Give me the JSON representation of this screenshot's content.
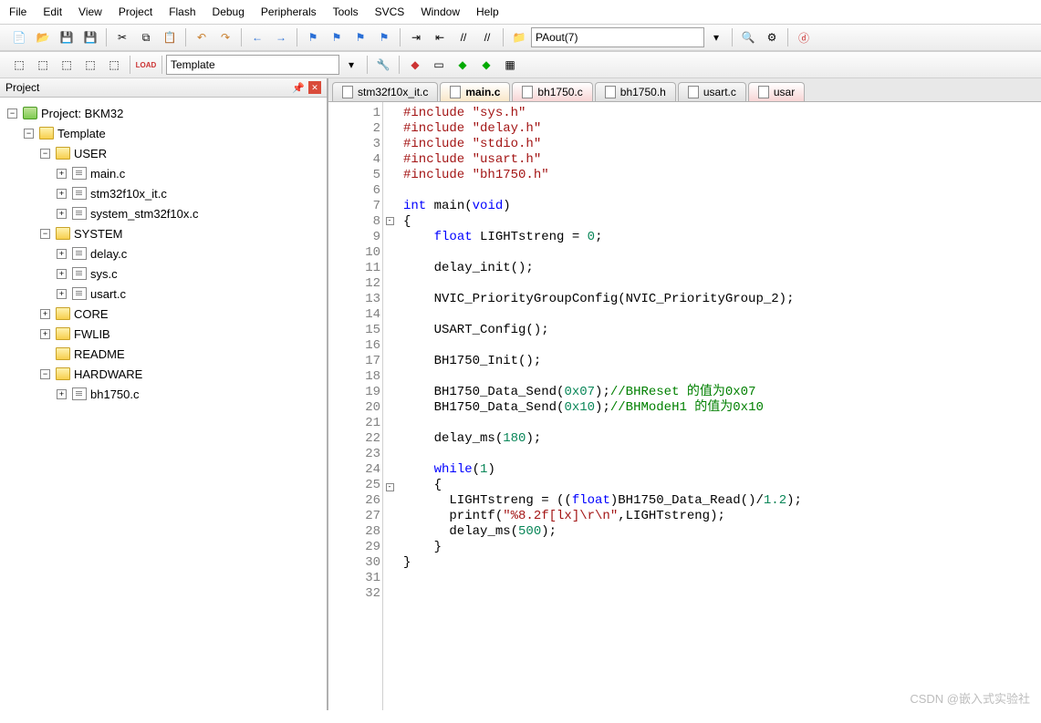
{
  "menu": [
    "File",
    "Edit",
    "View",
    "Project",
    "Flash",
    "Debug",
    "Peripherals",
    "Tools",
    "SVCS",
    "Window",
    "Help"
  ],
  "toolbar1": {
    "combo_text": "PAout(7)"
  },
  "toolbar2": {
    "target_name": "Template"
  },
  "project_pane": {
    "title": "Project",
    "root": "Project: BKM32",
    "target": "Template",
    "groups": [
      {
        "name": "USER",
        "open": true,
        "files": [
          "main.c",
          "stm32f10x_it.c",
          "system_stm32f10x.c"
        ]
      },
      {
        "name": "SYSTEM",
        "open": true,
        "files": [
          "delay.c",
          "sys.c",
          "usart.c"
        ]
      },
      {
        "name": "CORE",
        "open": false,
        "files": []
      },
      {
        "name": "FWLIB",
        "open": false,
        "files": []
      },
      {
        "name": "README",
        "open": false,
        "files": [],
        "noexpand": true
      },
      {
        "name": "HARDWARE",
        "open": true,
        "files": [
          "bh1750.c"
        ]
      }
    ]
  },
  "tabs": [
    {
      "label": "stm32f10x_it.c",
      "style": "plain"
    },
    {
      "label": "main.c",
      "style": "active"
    },
    {
      "label": "bh1750.c",
      "style": "pink"
    },
    {
      "label": "bh1750.h",
      "style": "plain"
    },
    {
      "label": "usart.c",
      "style": "plain"
    },
    {
      "label": "usar",
      "style": "pink"
    }
  ],
  "code": {
    "lines": [
      {
        "n": 1,
        "h": "<span class='c-pp'>#include</span> <span class='c-str'>\"sys.h\"</span>"
      },
      {
        "n": 2,
        "h": "<span class='c-pp'>#include</span> <span class='c-str'>\"delay.h\"</span>"
      },
      {
        "n": 3,
        "h": "<span class='c-pp'>#include</span> <span class='c-str'>\"stdio.h\"</span>"
      },
      {
        "n": 4,
        "h": "<span class='c-pp'>#include</span> <span class='c-str'>\"usart.h\"</span>"
      },
      {
        "n": 5,
        "h": "<span class='c-pp'>#include</span> <span class='c-str'>\"bh1750.h\"</span>"
      },
      {
        "n": 6,
        "h": ""
      },
      {
        "n": 7,
        "h": "<span class='c-kw'>int</span> main(<span class='c-kw'>void</span>)"
      },
      {
        "n": 8,
        "h": "{",
        "fold": "-"
      },
      {
        "n": 9,
        "h": "    <span class='c-kw'>float</span> LIGHTstreng = <span class='c-num'>0</span>;"
      },
      {
        "n": 10,
        "h": ""
      },
      {
        "n": 11,
        "h": "    delay_init();"
      },
      {
        "n": 12,
        "h": ""
      },
      {
        "n": 13,
        "h": "    NVIC_PriorityGroupConfig(NVIC_PriorityGroup_2);"
      },
      {
        "n": 14,
        "h": ""
      },
      {
        "n": 15,
        "h": "    USART_Config();"
      },
      {
        "n": 16,
        "h": ""
      },
      {
        "n": 17,
        "h": "    BH1750_Init();"
      },
      {
        "n": 18,
        "h": ""
      },
      {
        "n": 19,
        "h": "    BH1750_Data_Send(<span class='c-num'>0x07</span>);<span class='c-cmt'>//BHReset 的值为0x07</span>"
      },
      {
        "n": 20,
        "h": "    BH1750_Data_Send(<span class='c-num'>0x10</span>);<span class='c-cmt'>//BHModeH1 的值为0x10</span>"
      },
      {
        "n": 21,
        "h": ""
      },
      {
        "n": 22,
        "h": "    delay_ms(<span class='c-num'>180</span>);"
      },
      {
        "n": 23,
        "h": ""
      },
      {
        "n": 24,
        "h": "    <span class='c-kw'>while</span>(<span class='c-num'>1</span>)"
      },
      {
        "n": 25,
        "h": "    {",
        "fold": "-"
      },
      {
        "n": 26,
        "h": "      LIGHTstreng = ((<span class='c-kw'>float</span>)BH1750_Data_Read()/<span class='c-num'>1.2</span>);"
      },
      {
        "n": 27,
        "h": "      printf(<span class='c-str'>\"%8.2f[lx]\\r\\n\"</span>,LIGHTstreng);"
      },
      {
        "n": 28,
        "h": "      delay_ms(<span class='c-num'>500</span>);"
      },
      {
        "n": 29,
        "h": "    }"
      },
      {
        "n": 30,
        "h": "}"
      },
      {
        "n": 31,
        "h": ""
      },
      {
        "n": 32,
        "h": ""
      }
    ]
  },
  "watermark": "CSDN @嵌入式实验社"
}
